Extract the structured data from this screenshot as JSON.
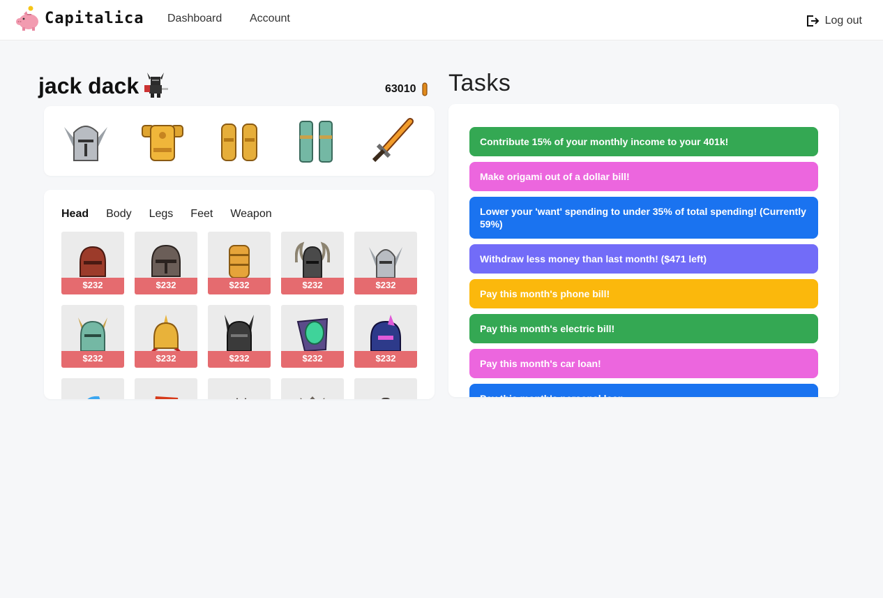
{
  "app": {
    "name": "Capitalica"
  },
  "nav": {
    "dashboard": "Dashboard",
    "account": "Account",
    "logout": "Log out"
  },
  "profile": {
    "name": "jack dack",
    "coins": "63010"
  },
  "equipped": [
    "helmet-icon",
    "armor-icon",
    "gauntlets-icon",
    "greaves-icon",
    "sword-icon"
  ],
  "shop": {
    "tabs": [
      "Head",
      "Body",
      "Legs",
      "Feet",
      "Weapon"
    ],
    "active_tab": "Head",
    "items": [
      {
        "icon": "red-helmet-icon",
        "price": "$232"
      },
      {
        "icon": "dark-helmet-icon",
        "price": "$232"
      },
      {
        "icon": "gold-barrel-helmet-icon",
        "price": "$232"
      },
      {
        "icon": "horned-helmet-icon",
        "price": "$232"
      },
      {
        "icon": "silver-winged-helmet-icon",
        "price": "$232"
      },
      {
        "icon": "teal-horned-helmet-icon",
        "price": "$232"
      },
      {
        "icon": "gold-spiked-helmet-icon",
        "price": "$232"
      },
      {
        "icon": "black-horned-helmet-icon",
        "price": "$232"
      },
      {
        "icon": "emerald-helmet-icon",
        "price": "$232"
      },
      {
        "icon": "galaxy-helmet-icon",
        "price": "$232"
      },
      {
        "icon": "blue-helmet-icon",
        "price": ""
      },
      {
        "icon": "red-dragon-helmet-icon",
        "price": ""
      },
      {
        "icon": "dark-crown-helmet-icon",
        "price": ""
      },
      {
        "icon": "grey-crown-helmet-icon",
        "price": ""
      },
      {
        "icon": "small-helmet-icon",
        "price": ""
      }
    ]
  },
  "tasks": {
    "title": "Tasks",
    "items": [
      {
        "text": "Contribute 15% of your monthly income to your 401k!",
        "color": "#34a853"
      },
      {
        "text": "Make origami out of a dollar bill!",
        "color": "#ec66de"
      },
      {
        "text": "Lower your 'want' spending to under 35% of total spending! (Currently 59%)",
        "color": "#1a73f0"
      },
      {
        "text": "Withdraw less money than last month! ($471 left)",
        "color": "#726cf8"
      },
      {
        "text": "Pay this month's phone bill!",
        "color": "#fbb80c"
      },
      {
        "text": "Pay this month's electric bill!",
        "color": "#34a853"
      },
      {
        "text": "Pay this month's car loan!",
        "color": "#ec66de"
      },
      {
        "text": "Pay this month's personal loan",
        "color": "#1a73f0"
      }
    ]
  },
  "colors": {
    "price_banner": "#e56b6f",
    "brand_pink": "#f29bb0"
  }
}
